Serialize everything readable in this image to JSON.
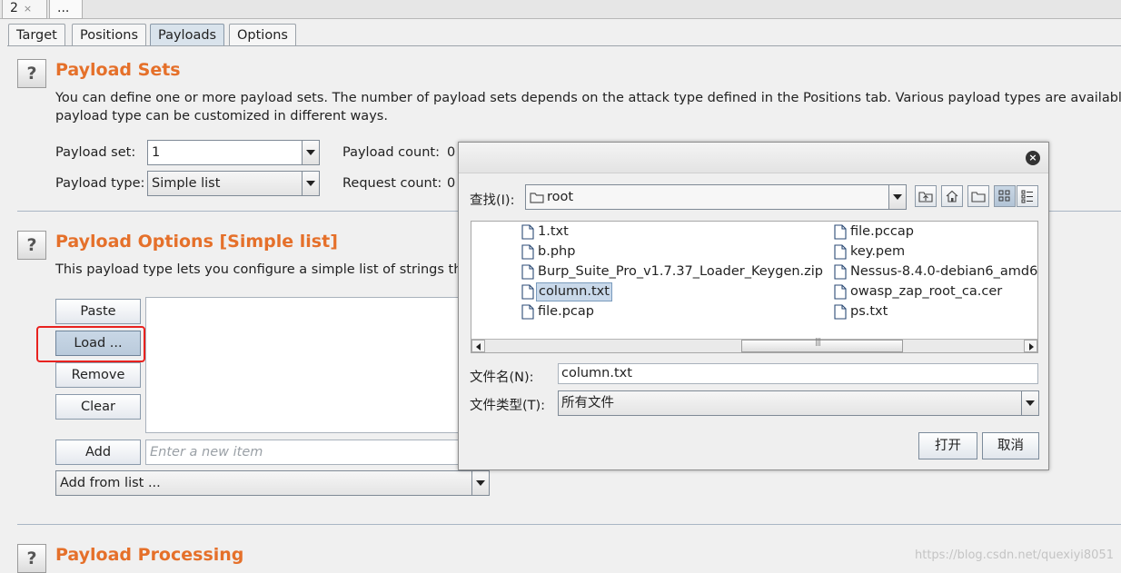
{
  "top_tabs": [
    {
      "label": "2",
      "close": "×"
    },
    {
      "label": "..."
    }
  ],
  "sub_tabs": [
    "Target",
    "Positions",
    "Payloads",
    "Options"
  ],
  "help_glyph": "?",
  "payload_sets": {
    "title": "Payload Sets",
    "description_line1": "You can define one or more payload sets. The number of payload sets depends on the attack type defined in the Positions tab. Various payload types are available f",
    "description_line2": "payload type can be customized in different ways.",
    "payload_set_label": "Payload set:",
    "payload_set_value": "1",
    "payload_type_label": "Payload type:",
    "payload_type_value": "Simple list",
    "payload_count_label": "Payload count:",
    "payload_count_value": "0",
    "request_count_label": "Request count:",
    "request_count_value": "0"
  },
  "payload_options": {
    "title": "Payload Options [Simple list]",
    "description": "This payload type lets you configure a simple list of strings tha",
    "buttons": {
      "paste": "Paste",
      "load": "Load ...",
      "remove": "Remove",
      "clear": "Clear",
      "add": "Add"
    },
    "new_item_placeholder": "Enter a new item",
    "add_from_list": "Add from list ..."
  },
  "payload_processing": {
    "title": "Payload Processing"
  },
  "dialog": {
    "close_glyph": "×",
    "look_in_label": "查找(I):",
    "look_in_value": "root",
    "files_left": [
      "1.txt",
      "b.php",
      "Burp_Suite_Pro_v1.7.37_Loader_Keygen.zip",
      "column.txt",
      "file.pcap"
    ],
    "files_right": [
      "file.pccap",
      "key.pem",
      "Nessus-8.4.0-debian6_amd6",
      "owasp_zap_root_ca.cer",
      "ps.txt"
    ],
    "selected_file": "column.txt",
    "filename_label": "文件名(N):",
    "filename_value": "column.txt",
    "filetype_label": "文件类型(T):",
    "filetype_value": "所有文件",
    "open_button": "打开",
    "cancel_button": "取消"
  },
  "watermark": "https://blog.csdn.net/quexiyi8051",
  "colors": {
    "heading": "#e5702a",
    "highlight_box": "#e8221f",
    "selection": "#c9d9ea"
  }
}
